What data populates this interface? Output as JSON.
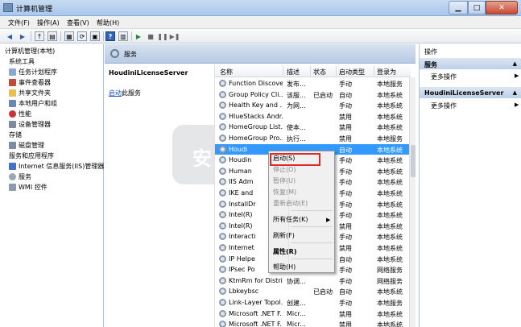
{
  "window": {
    "title": "计算机管理"
  },
  "menu": {
    "file": "文件(F)",
    "action": "操作(A)",
    "view": "查看(V)",
    "help": "帮助(H)"
  },
  "tree": {
    "root": "计算机管理(本地)",
    "items": [
      {
        "label": "系统工具"
      },
      {
        "label": "任务计划程序"
      },
      {
        "label": "事件查看器"
      },
      {
        "label": "共享文件夹"
      },
      {
        "label": "本地用户和组"
      },
      {
        "label": "性能"
      },
      {
        "label": "设备管理器"
      },
      {
        "label": "存储"
      },
      {
        "label": "磁盘管理"
      },
      {
        "label": "服务和应用程序"
      },
      {
        "label": "Internet 信息服务(IIS)管理器"
      },
      {
        "label": "服务"
      },
      {
        "label": "WMI 控件"
      }
    ]
  },
  "middle": {
    "header": "服务",
    "selected_service": "HoudiniLicenseServer",
    "detail_link": "启动",
    "detail_suffix": "此服务"
  },
  "list": {
    "columns": {
      "name": "名称",
      "desc": "描述",
      "status": "状态",
      "startup": "启动类型",
      "logon": "登录为"
    },
    "rows": [
      {
        "name": "Function Discove...",
        "desc": "发布...",
        "status": "",
        "startup": "手动",
        "logon": "本地服务"
      },
      {
        "name": "Group Policy Cli...",
        "desc": "该服...",
        "status": "已启动",
        "startup": "自动",
        "logon": "本地系统"
      },
      {
        "name": "Health Key and ...",
        "desc": "为网...",
        "status": "",
        "startup": "手动",
        "logon": "本地系统"
      },
      {
        "name": "HlueStacks Andr...",
        "desc": "",
        "status": "",
        "startup": "禁用",
        "logon": "本地系统"
      },
      {
        "name": "HomeGroup List...",
        "desc": "使本...",
        "status": "",
        "startup": "禁用",
        "logon": "本地系统"
      },
      {
        "name": "HomeGroup Pro...",
        "desc": "执行...",
        "status": "",
        "startup": "禁用",
        "logon": "本地服务"
      },
      {
        "name": "Houdi",
        "desc": "",
        "status": "",
        "startup": "自动",
        "logon": "本地系统"
      },
      {
        "name": "Houdin",
        "desc": "",
        "status": "",
        "startup": "手动",
        "logon": "本地系统"
      },
      {
        "name": "Human",
        "desc": "",
        "status": "",
        "startup": "手动",
        "logon": "本地系统"
      },
      {
        "name": "IIS Adm",
        "desc": "",
        "status": "",
        "startup": "手动",
        "logon": "本地系统"
      },
      {
        "name": "IKE and",
        "desc": "",
        "status": "",
        "startup": "手动",
        "logon": "本地系统"
      },
      {
        "name": "InstallDr",
        "desc": "",
        "status": "",
        "startup": "手动",
        "logon": "本地系统"
      },
      {
        "name": "Intel(R)",
        "desc": "",
        "status": "",
        "startup": "手动",
        "logon": "本地系统"
      },
      {
        "name": "Intel(R)",
        "desc": "",
        "status": "",
        "startup": "禁用",
        "logon": "本地系统"
      },
      {
        "name": "Interacti",
        "desc": "",
        "status": "",
        "startup": "手动",
        "logon": "本地系统"
      },
      {
        "name": "Internet",
        "desc": "",
        "status": "",
        "startup": "禁用",
        "logon": "本地系统"
      },
      {
        "name": "IP Helpe",
        "desc": "",
        "status": "",
        "startup": "自动",
        "logon": "本地系统"
      },
      {
        "name": "IPsec Po",
        "desc": "",
        "status": "",
        "startup": "手动",
        "logon": "网络服务"
      },
      {
        "name": "KtmRm for Distri...",
        "desc": "协调...",
        "status": "",
        "startup": "手动",
        "logon": "网络服务"
      },
      {
        "name": "Lbkeybsc",
        "desc": "",
        "status": "已启动",
        "startup": "自动",
        "logon": "本地系统"
      },
      {
        "name": "Link-Layer Topol...",
        "desc": "创建...",
        "status": "",
        "startup": "手动",
        "logon": "本地服务"
      },
      {
        "name": "Microsoft .NET F...",
        "desc": "Micr...",
        "status": "",
        "startup": "禁用",
        "logon": "本地系统"
      },
      {
        "name": "Microsoft .NET F...",
        "desc": "Micr...",
        "status": "",
        "startup": "禁用",
        "logon": "本地系统"
      }
    ]
  },
  "context_menu": {
    "start": "启动(S)",
    "stop": "停止(O)",
    "pause": "暂停(U)",
    "resume": "恢复(M)",
    "restart": "重新启动(E)",
    "all_tasks": "所有任务(K)",
    "refresh": "刷新(F)",
    "properties": "属性(R)",
    "help": "帮助(H)"
  },
  "actions": {
    "title": "操作",
    "group1": "服务",
    "more1": "更多操作",
    "group2": "HoudiniLicenseServer",
    "more2": "更多操作"
  },
  "watermark": {
    "text": "安"
  }
}
